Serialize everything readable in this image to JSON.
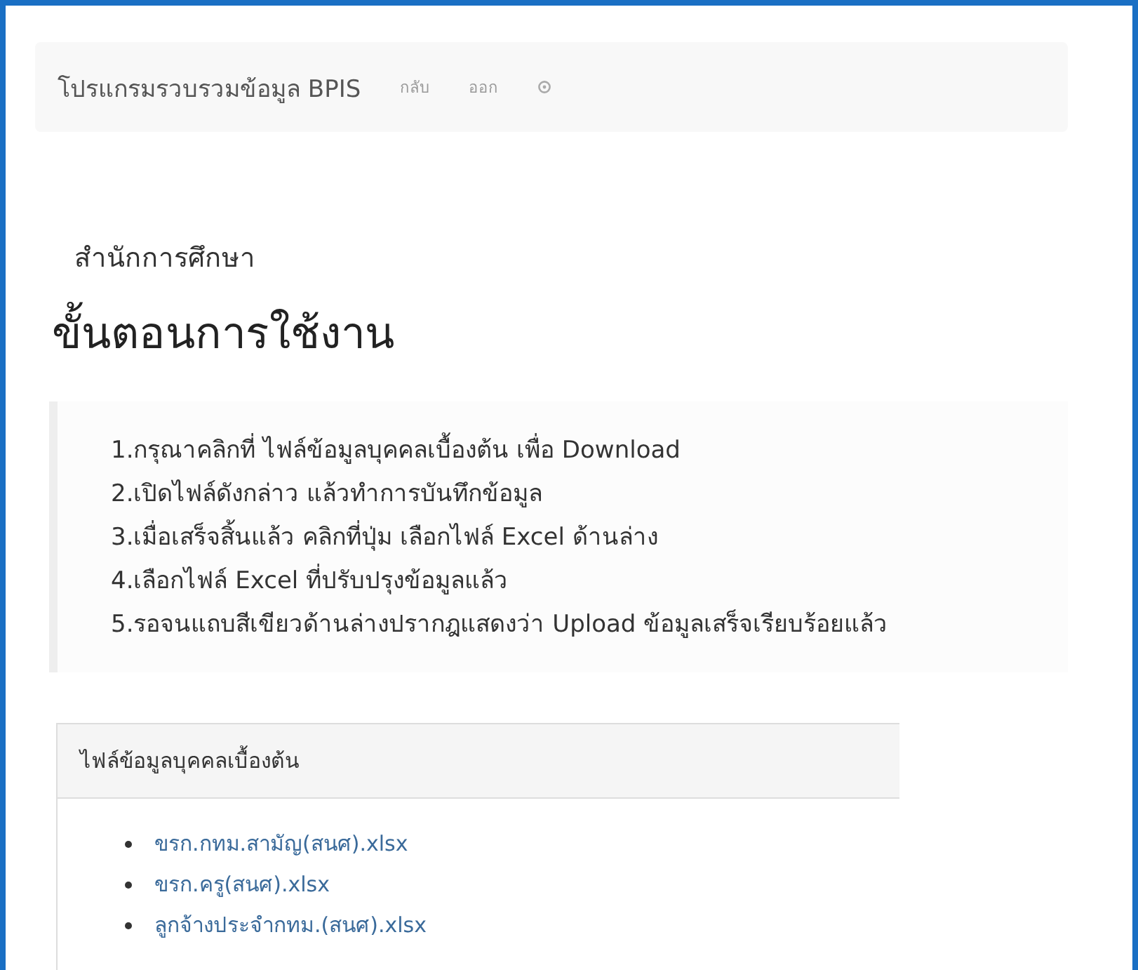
{
  "navbar": {
    "brand": "โปรแกรมรวบรวมข้อมูล BPIS",
    "links": [
      "กลับ",
      "ออก"
    ]
  },
  "subtitle": "สำนักการศึกษา",
  "heading": "ขั้นตอนการใช้งาน",
  "steps": [
    "1.กรุณาคลิกที่ ไฟล์ข้อมูลบุคคลเบื้องต้น เพื่อ Download",
    "2.เปิดไฟล์ดังกล่าว แล้วทำการบันทึกข้อมูล",
    "3.เมื่อเสร็จสิ้นแล้ว คลิกที่ปุ่ม เลือกไฟล์ Excel ด้านล่าง",
    "4.เลือกไฟล์ Excel ที่ปรับปรุงข้อมูลแล้ว",
    "5.รอจนแถบสีเขียวด้านล่างปรากฎแสดงว่า Upload ข้อมูลเสร็จเรียบร้อยแล้ว"
  ],
  "panel": {
    "title": "ไฟล์ข้อมูลบุคคลเบื้องต้น",
    "files": [
      "ขรก.กทม.สามัญ(สนศ).xlsx",
      "ขรก.ครู(สนศ).xlsx",
      "ลูกจ้างประจำกทม.(สนศ).xlsx"
    ]
  }
}
